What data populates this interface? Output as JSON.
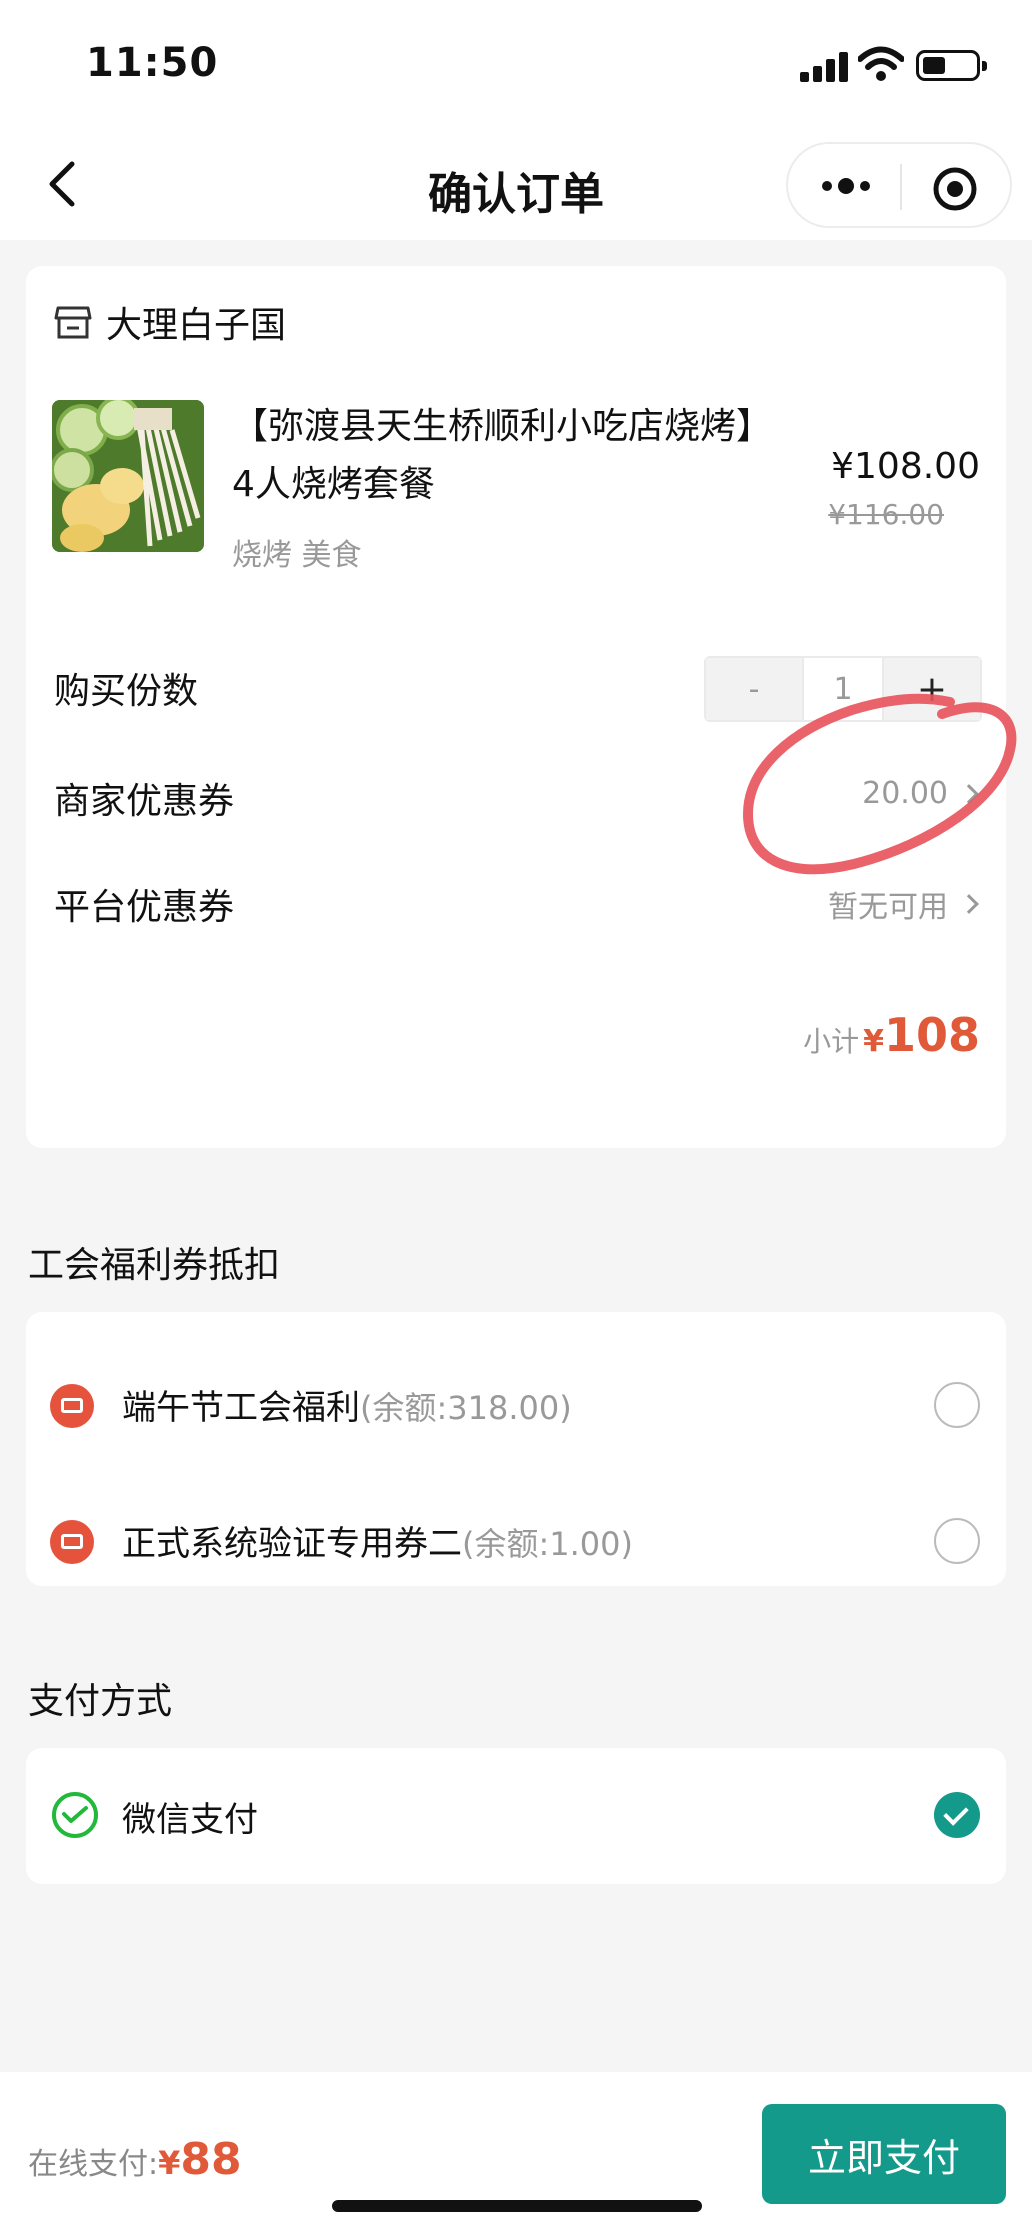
{
  "status_bar": {
    "time": "11:50"
  },
  "nav": {
    "title": "确认订单"
  },
  "order": {
    "shop_name": "大理白子国",
    "product_title": "【弥渡县天生桥顺利小吃店烧烤】4人烧烤套餐",
    "product_tags": "烧烤 美食",
    "price_now": "¥108.00",
    "price_orig": "¥116.00",
    "qty_label": "购买份数",
    "qty_minus": "-",
    "qty_value": "1",
    "qty_plus": "+",
    "merchant_coupon_label": "商家优惠券",
    "merchant_coupon_value": "20.00",
    "platform_coupon_label": "平台优惠券",
    "platform_coupon_value": "暂无可用",
    "subtotal_label": "小计",
    "subtotal_currency": "¥",
    "subtotal_amount": "108"
  },
  "union": {
    "section_title": "工会福利券抵扣",
    "coupons": [
      {
        "name": "端午节工会福利",
        "balance": "(余额:318.00)"
      },
      {
        "name": "正式系统验证专用券二",
        "balance": "(余额:1.00)"
      }
    ]
  },
  "payment": {
    "section_title": "支付方式",
    "method": "微信支付"
  },
  "footer": {
    "total_label": "在线支付:",
    "total_currency": "¥",
    "total_amount": "88",
    "pay_button": "立即支付"
  },
  "colors": {
    "accent": "#149a8a",
    "price": "#e05a3a",
    "coupon_icon": "#e5533d",
    "annotation": "#e8525a"
  }
}
